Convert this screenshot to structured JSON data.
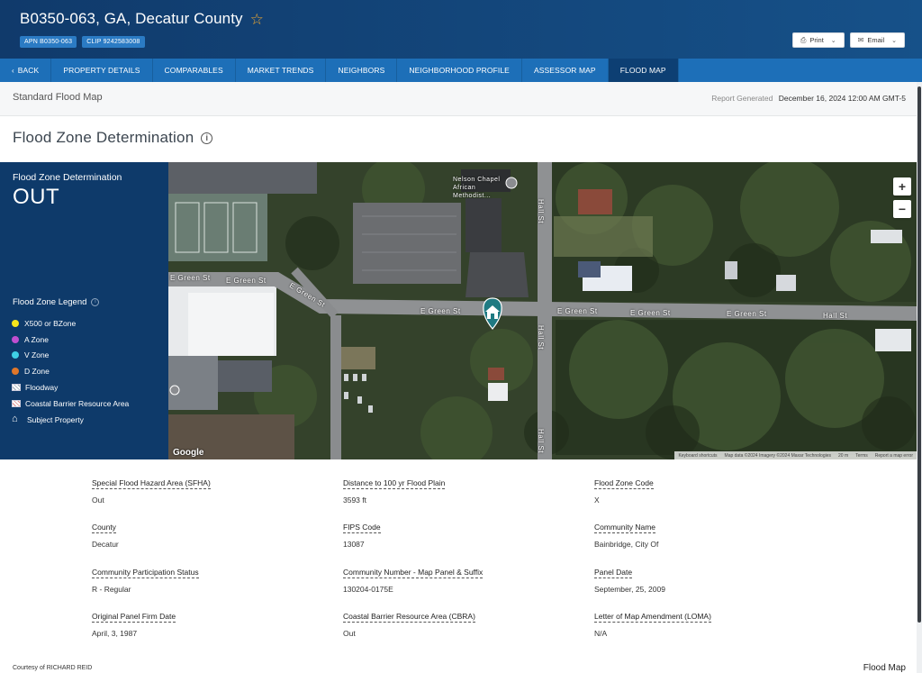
{
  "header": {
    "title": "B0350-063, GA, Decatur County",
    "apn_badge": "APN B0350-063",
    "clip_badge": "CLIP 9242583008",
    "print_label": "Print",
    "email_label": "Email"
  },
  "nav": {
    "back": "BACK",
    "items": [
      "PROPERTY DETAILS",
      "COMPARABLES",
      "MARKET TRENDS",
      "NEIGHBORS",
      "NEIGHBORHOOD PROFILE",
      "ASSESSOR MAP",
      "FLOOD MAP"
    ],
    "active": "FLOOD MAP"
  },
  "subheader": {
    "title": "Standard Flood Map",
    "report_generated_label": "Report Generated",
    "report_generated_value": "December 16, 2024 12:00 AM GMT-5"
  },
  "section_title": "Flood Zone Determination",
  "legend_panel": {
    "title": "Flood Zone Determination",
    "value": "OUT",
    "legend_title": "Flood Zone Legend",
    "items": [
      {
        "label": "X500 or BZone",
        "color": "#f5e51b"
      },
      {
        "label": "A Zone",
        "color": "#c04fd0"
      },
      {
        "label": "V Zone",
        "color": "#3fd0e6"
      },
      {
        "label": "D Zone",
        "color": "#e0772a"
      },
      {
        "label": "Floodway",
        "icon": "hatch-icon"
      },
      {
        "label": "Coastal Barrier Resource Area",
        "icon": "hatch-red-icon"
      },
      {
        "label": "Subject Property",
        "icon": "home-icon"
      }
    ]
  },
  "map": {
    "streets": [
      "E Green St",
      "E Green St",
      "E Green St",
      "E Green St",
      "E Green St",
      "E Green St",
      "E Green St",
      "Hall St",
      "Hall St",
      "Hall St"
    ],
    "poi_label": "Nelson Chapel African Methodist...",
    "google": "Google",
    "attribution": [
      "Keyboard shortcuts",
      "Map data ©2024 Imagery ©2024 Maxar Technologies",
      "20 m",
      "Terms",
      "Report a map error"
    ],
    "zoom_in": "+",
    "zoom_out": "−"
  },
  "details": [
    {
      "label": "Special Flood Hazard Area (SFHA)",
      "value": "Out"
    },
    {
      "label": "Distance to 100 yr Flood Plain",
      "value": "3593 ft"
    },
    {
      "label": "Flood Zone Code",
      "value": "X"
    },
    {
      "label": "County",
      "value": "Decatur"
    },
    {
      "label": "FIPS Code",
      "value": "13087"
    },
    {
      "label": "Community Name",
      "value": "Bainbridge, City Of"
    },
    {
      "label": "Community Participation Status",
      "value": "R - Regular"
    },
    {
      "label": "Community Number - Map Panel & Suffix",
      "value": "130204-0175E"
    },
    {
      "label": "Panel Date",
      "value": "September, 25, 2009"
    },
    {
      "label": "Original Panel Firm Date",
      "value": "April, 3, 1987"
    },
    {
      "label": "Coastal Barrier Resource Area (CBRA)",
      "value": "Out"
    },
    {
      "label": "Letter of Map Amendment (LOMA)",
      "value": "N/A"
    }
  ],
  "footer": {
    "courtesy": "Courtesy of RICHARD REID",
    "right": "Flood Map"
  }
}
